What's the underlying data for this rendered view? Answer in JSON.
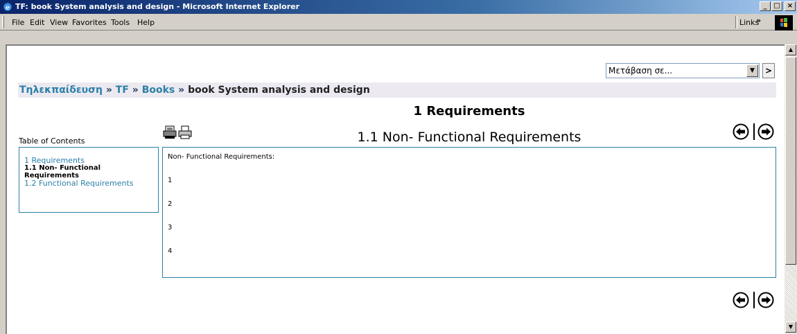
{
  "window": {
    "title": "TF: book System analysis and design - Microsoft Internet Explorer",
    "minimize": "_",
    "maximize": "□",
    "close": "×"
  },
  "menu": {
    "items": [
      {
        "underline": "F",
        "rest": "ile"
      },
      {
        "underline": "E",
        "rest": "dit"
      },
      {
        "underline": "V",
        "rest": "iew"
      },
      {
        "underline": "",
        "rest": "Favorites",
        "pre": "F",
        "u2": "a"
      },
      {
        "underline": "T",
        "rest": "ools"
      },
      {
        "underline": "H",
        "rest": "elp"
      }
    ],
    "labels": [
      "File",
      "Edit",
      "View",
      "Favorites",
      "Tools",
      "Help"
    ],
    "links": "Links",
    "links_chevron": "»"
  },
  "jump": {
    "selected": "Μετάβαση σε...",
    "arrow": "▼",
    "go": ">"
  },
  "breadcrumb": {
    "home": "Τηλεκπαίδευση",
    "sep": "»",
    "course": "TF",
    "books": "Books",
    "current": "book System analysis and design"
  },
  "chapter_title": "1 Requirements",
  "section_title": "1.1 Non- Functional Requirements",
  "toc": {
    "heading": "Table of Contents",
    "items": [
      {
        "label": "1 Requirements",
        "current": false
      },
      {
        "label": "1.1 Non- Functional",
        "current": true
      },
      {
        "label": "Requirements",
        "current": true
      },
      {
        "label": "1.2 Functional Requirements",
        "current": false
      }
    ]
  },
  "body": {
    "lines": [
      "Non- Functional Requirements:",
      "1",
      "2",
      "3",
      "4"
    ]
  },
  "colors": {
    "link": "#2b7fa8",
    "titlebar_start": "#0a246a",
    "titlebar_end": "#a6caf0"
  },
  "icons": {
    "print_chapter": "print-book-icon",
    "print_page": "print-page-icon",
    "prev": "prev-arrow-icon",
    "next": "next-arrow-icon"
  }
}
